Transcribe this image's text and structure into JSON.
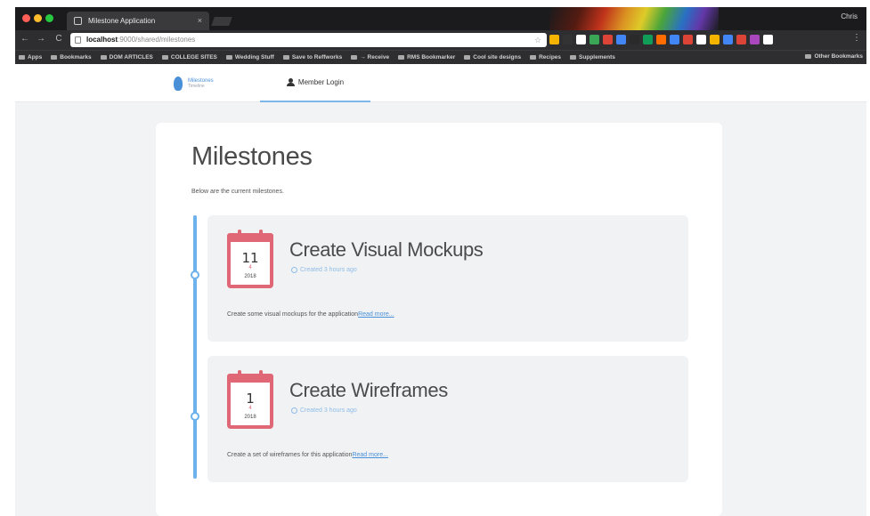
{
  "browser": {
    "tab_title": "Milestone Application",
    "tab_close": "×",
    "profile": "Chris",
    "nav_back": "←",
    "nav_forward": "→",
    "nav_reload": "C",
    "url_host": "localhost",
    "url_path": ":9000/shared/milestones",
    "menu": "⋮",
    "extension_colors": [
      "#f4b400",
      "#333333",
      "#ffffff",
      "#3aa757",
      "#db4437",
      "#4285f4",
      "#2a2a2a",
      "#0f9d58",
      "#ff6d00",
      "#4285f4",
      "#db4437",
      "#ffffff",
      "#f4b400",
      "#4285f4",
      "#db4437",
      "#ab47bc",
      "#ffffff"
    ],
    "bookmarks": [
      "Apps",
      "Bookmarks",
      "DOM ARTICLES",
      "COLLEGE SITES",
      "Wedding Stuff",
      "Save to Reffworks",
      "→ Receive",
      "RMS Bookmarker",
      "Cool site designs",
      "Recipes",
      "Supplements"
    ],
    "other_bookmarks": "Other Bookmarks"
  },
  "navbar": {
    "brand_title": "Milestones",
    "brand_sub": "Timeline",
    "login_label": "Member Login"
  },
  "page": {
    "title": "Milestones",
    "intro": "Below are the current milestones."
  },
  "milestones": [
    {
      "day": "11",
      "month": "4",
      "year": "2018",
      "title": "Create Visual Mockups",
      "meta": "Created 3 hours ago",
      "description": "Create some visual mockups for the application",
      "read_more": "Read more..."
    },
    {
      "day": "1",
      "month": "4",
      "year": "2018",
      "title": "Create Wireframes",
      "meta": "Created 3 hours ago",
      "description": "Create a set of wireframes for this application",
      "read_more": "Read more..."
    }
  ],
  "colors": {
    "accent": "#6cb2ec",
    "calendar": "#e06776",
    "link": "#4a90d9"
  }
}
